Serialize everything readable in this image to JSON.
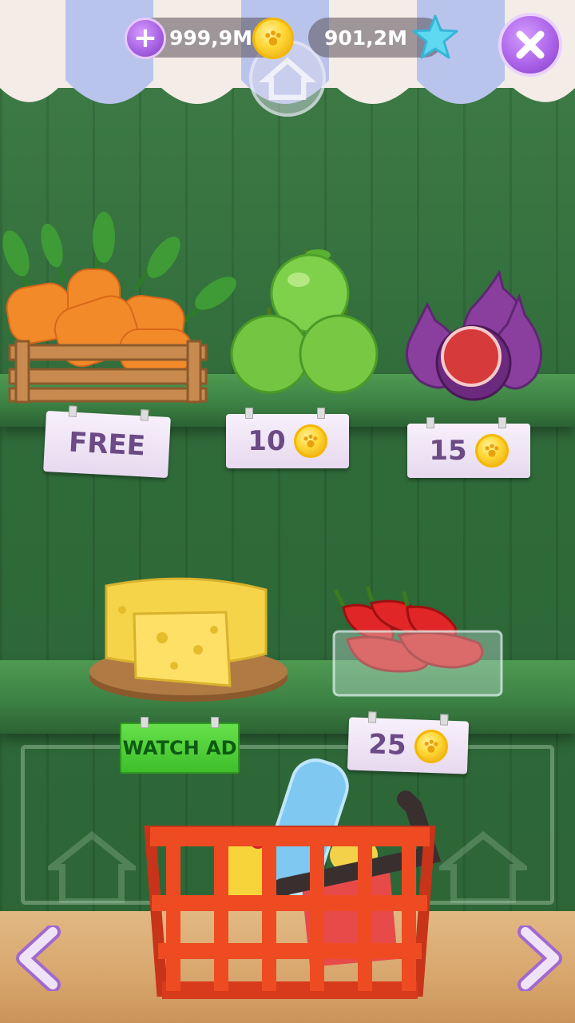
{
  "hud": {
    "coins": "999,9M",
    "stars": "901,2M",
    "plus_symbol": "+",
    "close_symbol": "✕"
  },
  "shop_items": [
    {
      "name": "carrots",
      "price": "FREE"
    },
    {
      "name": "apples",
      "price": "10"
    },
    {
      "name": "figs",
      "price": "15"
    },
    {
      "name": "cheese",
      "price": "WATCH AD"
    },
    {
      "name": "chili-peppers",
      "price": "25"
    }
  ],
  "colors": {
    "accent_purple": "#a35fe0",
    "coin_gold": "#ffd633",
    "star_cyan": "#5fd9f0",
    "watch_ad_green": "#3fbf2b",
    "shelf_green": "#3d8244"
  },
  "icons": [
    "plus-icon",
    "coin-icon",
    "star-icon",
    "close-icon",
    "home-icon",
    "left-arrow-icon",
    "right-arrow-icon",
    "basket-icon"
  ]
}
